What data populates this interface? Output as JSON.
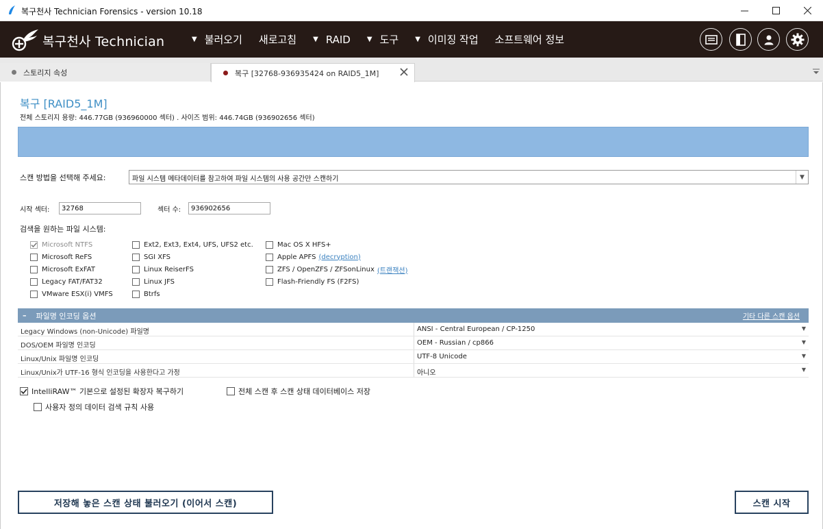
{
  "window": {
    "title": "복구천사 Technician Forensics - version 10.18"
  },
  "header": {
    "brand": "복구천사 Technician",
    "menu": [
      {
        "label": "불러오기",
        "has_dropdown": true
      },
      {
        "label": "새로고침",
        "has_dropdown": false
      },
      {
        "label": "RAID",
        "has_dropdown": true
      },
      {
        "label": "도구",
        "has_dropdown": true
      },
      {
        "label": "이미징 작업",
        "has_dropdown": true
      },
      {
        "label": "소프트웨어 정보",
        "has_dropdown": false
      }
    ],
    "icons": [
      "log-icon",
      "panel-icon",
      "account-icon",
      "settings-icon"
    ]
  },
  "tabs": [
    {
      "label": "스토리지 속성",
      "dot_color": "#7a7a7a",
      "active": false
    },
    {
      "label": "복구 [32768-936935424 on RAID5_1M]",
      "dot_color": "#8b1a1a",
      "active": true
    }
  ],
  "main": {
    "title": "복구 [RAID5_1M]",
    "capacity": "전체 스토리지 용량: 446.77GB (936960000 섹터) . 사이즈 범위: 446.74GB (936902656 섹터)",
    "scan_method_label": "스캔 방법을 선택해 주세요:",
    "scan_method_value": "파일 시스템 메타데이터를 참고하여 파일 시스템의 사용 공간만 스캔하기",
    "start_sector_label": "시작 섹터:",
    "start_sector_value": "32768",
    "sector_count_label": "섹터 수:",
    "sector_count_value": "936902656",
    "filesystems_heading": "검색을 원하는 파일 시스템:",
    "fs_col1": [
      {
        "label": "Microsoft NTFS",
        "checked": true,
        "disabled": true
      },
      {
        "label": "Microsoft ReFS",
        "checked": false
      },
      {
        "label": "Microsoft ExFAT",
        "checked": false
      },
      {
        "label": "Legacy FAT/FAT32",
        "checked": false
      },
      {
        "label": "VMware ESX(i) VMFS",
        "checked": false
      }
    ],
    "fs_col2": [
      {
        "label": "Ext2, Ext3, Ext4, UFS, UFS2 etc.",
        "checked": false
      },
      {
        "label": "SGI XFS",
        "checked": false
      },
      {
        "label": "Linux ReiserFS",
        "checked": false
      },
      {
        "label": "Linux JFS",
        "checked": false
      },
      {
        "label": "Btrfs",
        "checked": false
      }
    ],
    "fs_col3": [
      {
        "label": "Mac OS X HFS+",
        "checked": false,
        "link": ""
      },
      {
        "label": "Apple APFS",
        "checked": false,
        "link": "(decryption)"
      },
      {
        "label": "ZFS / OpenZFS / ZFSonLinux",
        "checked": false,
        "link": "(트랜잭션)"
      },
      {
        "label": "Flash-Friendly FS (F2FS)",
        "checked": false,
        "link": ""
      }
    ],
    "encoding": {
      "header": "파일명 인코딩 옵션",
      "collapse_symbol": "–",
      "other_link": "기타 다른 스캔 옵션",
      "rows": [
        {
          "key": "Legacy Windows (non-Unicode) 파일명",
          "value": "ANSI - Central European / CP-1250"
        },
        {
          "key": "DOS/OEM 파일명 인코딩",
          "value": "OEM - Russian / cp866"
        },
        {
          "key": "Linux/Unix 파일명 인코딩",
          "value": "UTF-8 Unicode"
        },
        {
          "key": "Linux/Unix가 UTF-16 형식 인코딩을 사용한다고 가정",
          "value": "아니오"
        }
      ]
    },
    "options": {
      "intelliraw": "IntelliRAW™ 기본으로 설정된 확장자 복구하기",
      "intelliraw_checked": true,
      "save_db": "전체 스캔 후 스캔 상태 데이터베이스 저장",
      "save_db_checked": false,
      "custom_rules": "사용자 정의 데이터 검색 규칙 사용",
      "custom_rules_checked": false
    },
    "load_button": "저장해 놓은 스캔 상태 불러오기 (이어서 스캔)",
    "start_button": "스캔 시작"
  },
  "colors": {
    "header_bg": "#261a16",
    "accent": "#3f8fc5",
    "map_bar": "#8eb8e2",
    "section_header": "#7b9bba"
  }
}
